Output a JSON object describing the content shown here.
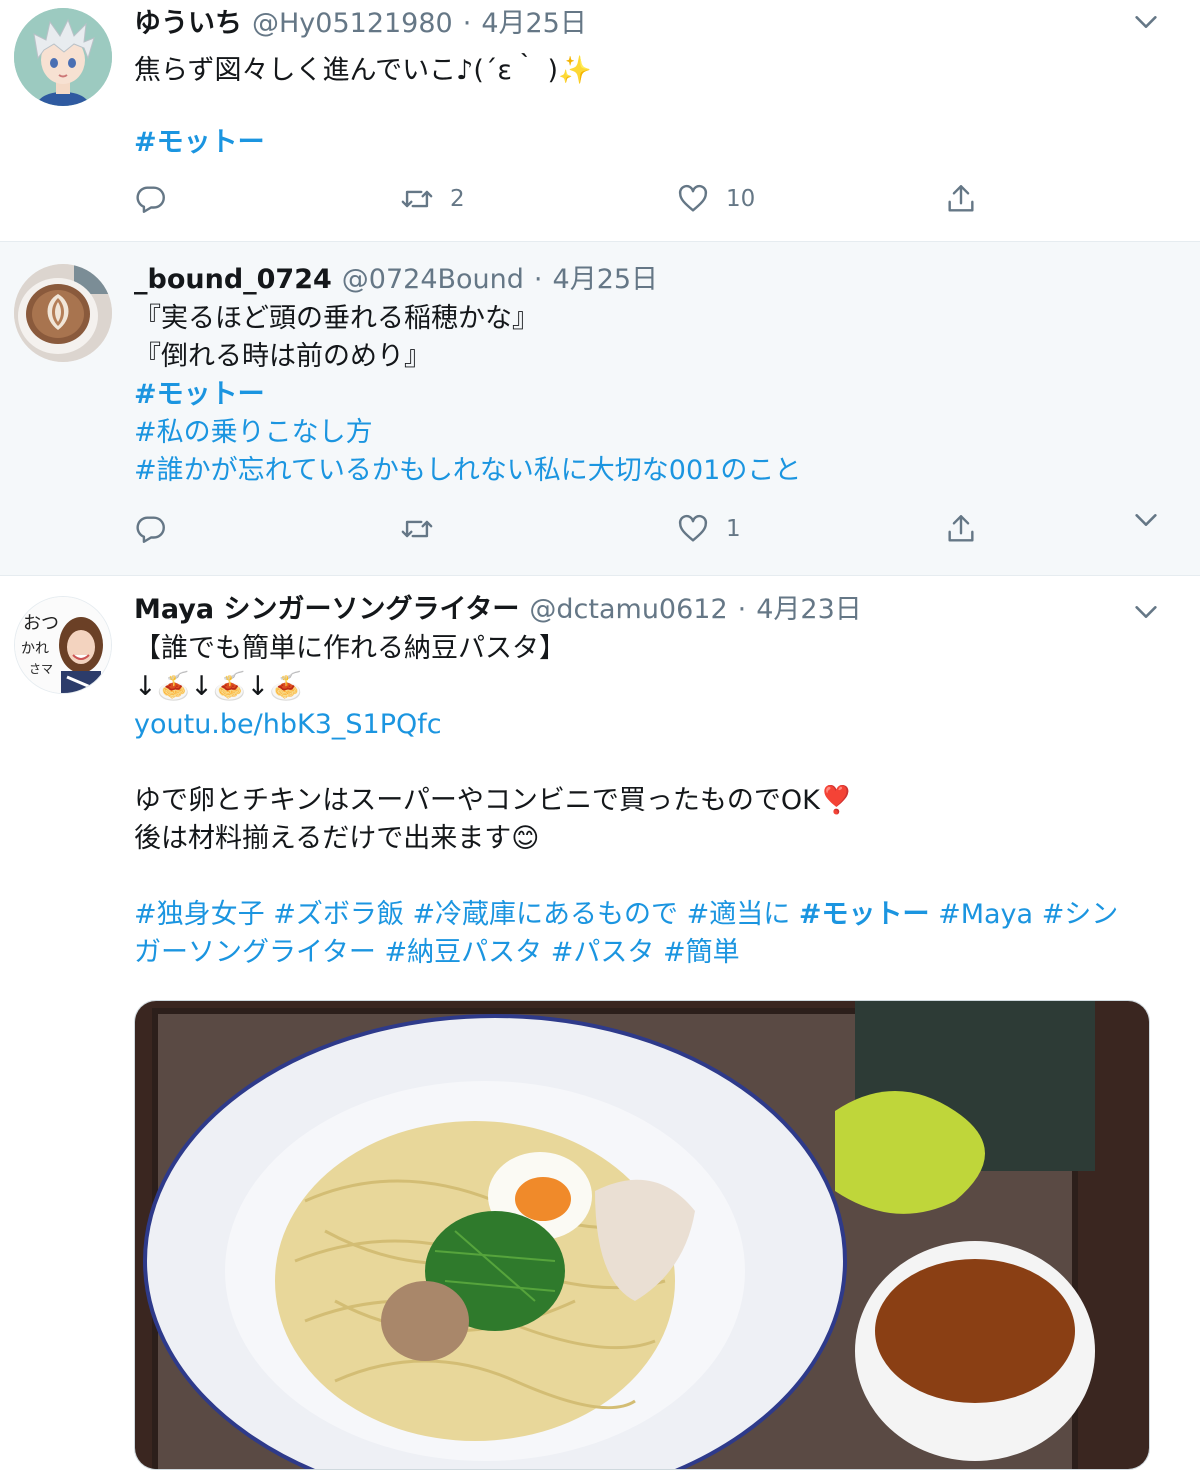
{
  "tweets": [
    {
      "name": "ゆういち",
      "handle": "@Hy05121980",
      "date": "4月25日",
      "line1": "焦らず図々しく進んでいこ♪(´ε｀ )✨",
      "tag1": "#モットー",
      "retweets": "2",
      "likes": "10"
    },
    {
      "name": "_bound_0724",
      "handle": "@0724Bound",
      "date": "4月25日",
      "line1": "『実るほど頭の垂れる稲穂かな』",
      "line2": "『倒れる時は前のめり』",
      "tag1": "#モットー",
      "tag2": "#私の乗りこなし方",
      "tag3": "#誰かが忘れているかもしれない私に大切な001のこと",
      "likes": "1"
    },
    {
      "name": "Maya シンガーソングライター",
      "handle": "@dctamu0612",
      "date": "4月23日",
      "line1": "【誰でも簡単に作れる納豆パスタ】",
      "line2": "↓🍝↓🍝↓🍝",
      "link": "youtu.be/hbK3_S1PQfc",
      "line3": "ゆで卵とチキンはスーパーやコンビニで買ったものでOK❣️",
      "line4": "後は材料揃えるだけで出来ます😊",
      "tags": [
        "#独身女子",
        "#ズボラ飯",
        "#冷蔵庫にあるもので",
        "#適当に",
        "#モットー",
        "#Maya",
        "#シンガーソングライター",
        "#納豆パスタ",
        "#パスタ",
        "#簡単"
      ],
      "avatar_text": "おつかれさマヤ"
    }
  ],
  "colors": {
    "accent": "#1b95e0",
    "muted": "#657786",
    "highlight_bg": "#f5f8fa"
  },
  "icons": [
    "reply-icon",
    "retweet-icon",
    "like-icon",
    "share-icon",
    "chevron-down-icon"
  ]
}
